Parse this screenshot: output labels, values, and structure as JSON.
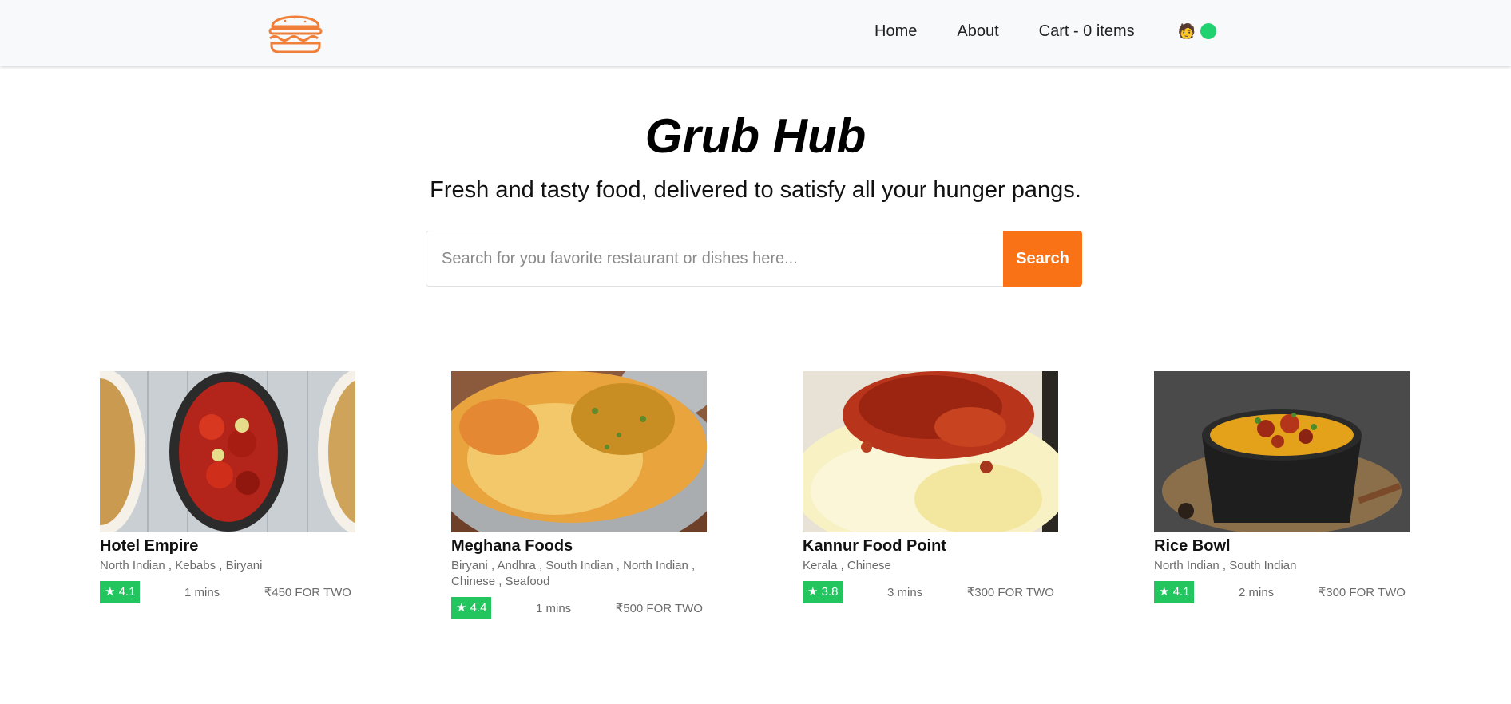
{
  "nav": {
    "logo": "burger-logo",
    "links": [
      "Home",
      "About",
      "Cart - 0 items"
    ],
    "user_icon": "user-avatar-icon",
    "status_color": "#1fd16f"
  },
  "hero": {
    "title": "Grub Hub",
    "subtitle": "Fresh and tasty food, delivered to satisfy all your hunger pangs."
  },
  "search": {
    "placeholder": "Search for you favorite restaurant or dishes here...",
    "value": "",
    "button_label": "Search"
  },
  "colors": {
    "accent": "#f97316",
    "rating": "#22c55e"
  },
  "restaurants": [
    {
      "name": "Hotel Empire",
      "cuisines": "North Indian , Kebabs , Biryani",
      "rating": "★ 4.1",
      "time": "1 mins",
      "cost": "₹450 FOR TWO",
      "image": "chicken-kebab-plate-image"
    },
    {
      "name": "Meghana Foods",
      "cuisines": "Biryani , Andhra , South Indian , North Indian , Chinese , Seafood",
      "rating": "★ 4.4",
      "time": "1 mins",
      "cost": "₹500 FOR TWO",
      "image": "biryani-bowl-image"
    },
    {
      "name": "Kannur Food Point",
      "cuisines": "Kerala , Chinese",
      "rating": "★ 3.8",
      "time": "3 mins",
      "cost": "₹300 FOR TWO",
      "image": "chicken-rice-plate-image"
    },
    {
      "name": "Rice Bowl",
      "cuisines": "North Indian , South Indian",
      "rating": "★ 4.1",
      "time": "2 mins",
      "cost": "₹300 FOR TWO",
      "image": "dal-chicken-bowl-image"
    }
  ]
}
